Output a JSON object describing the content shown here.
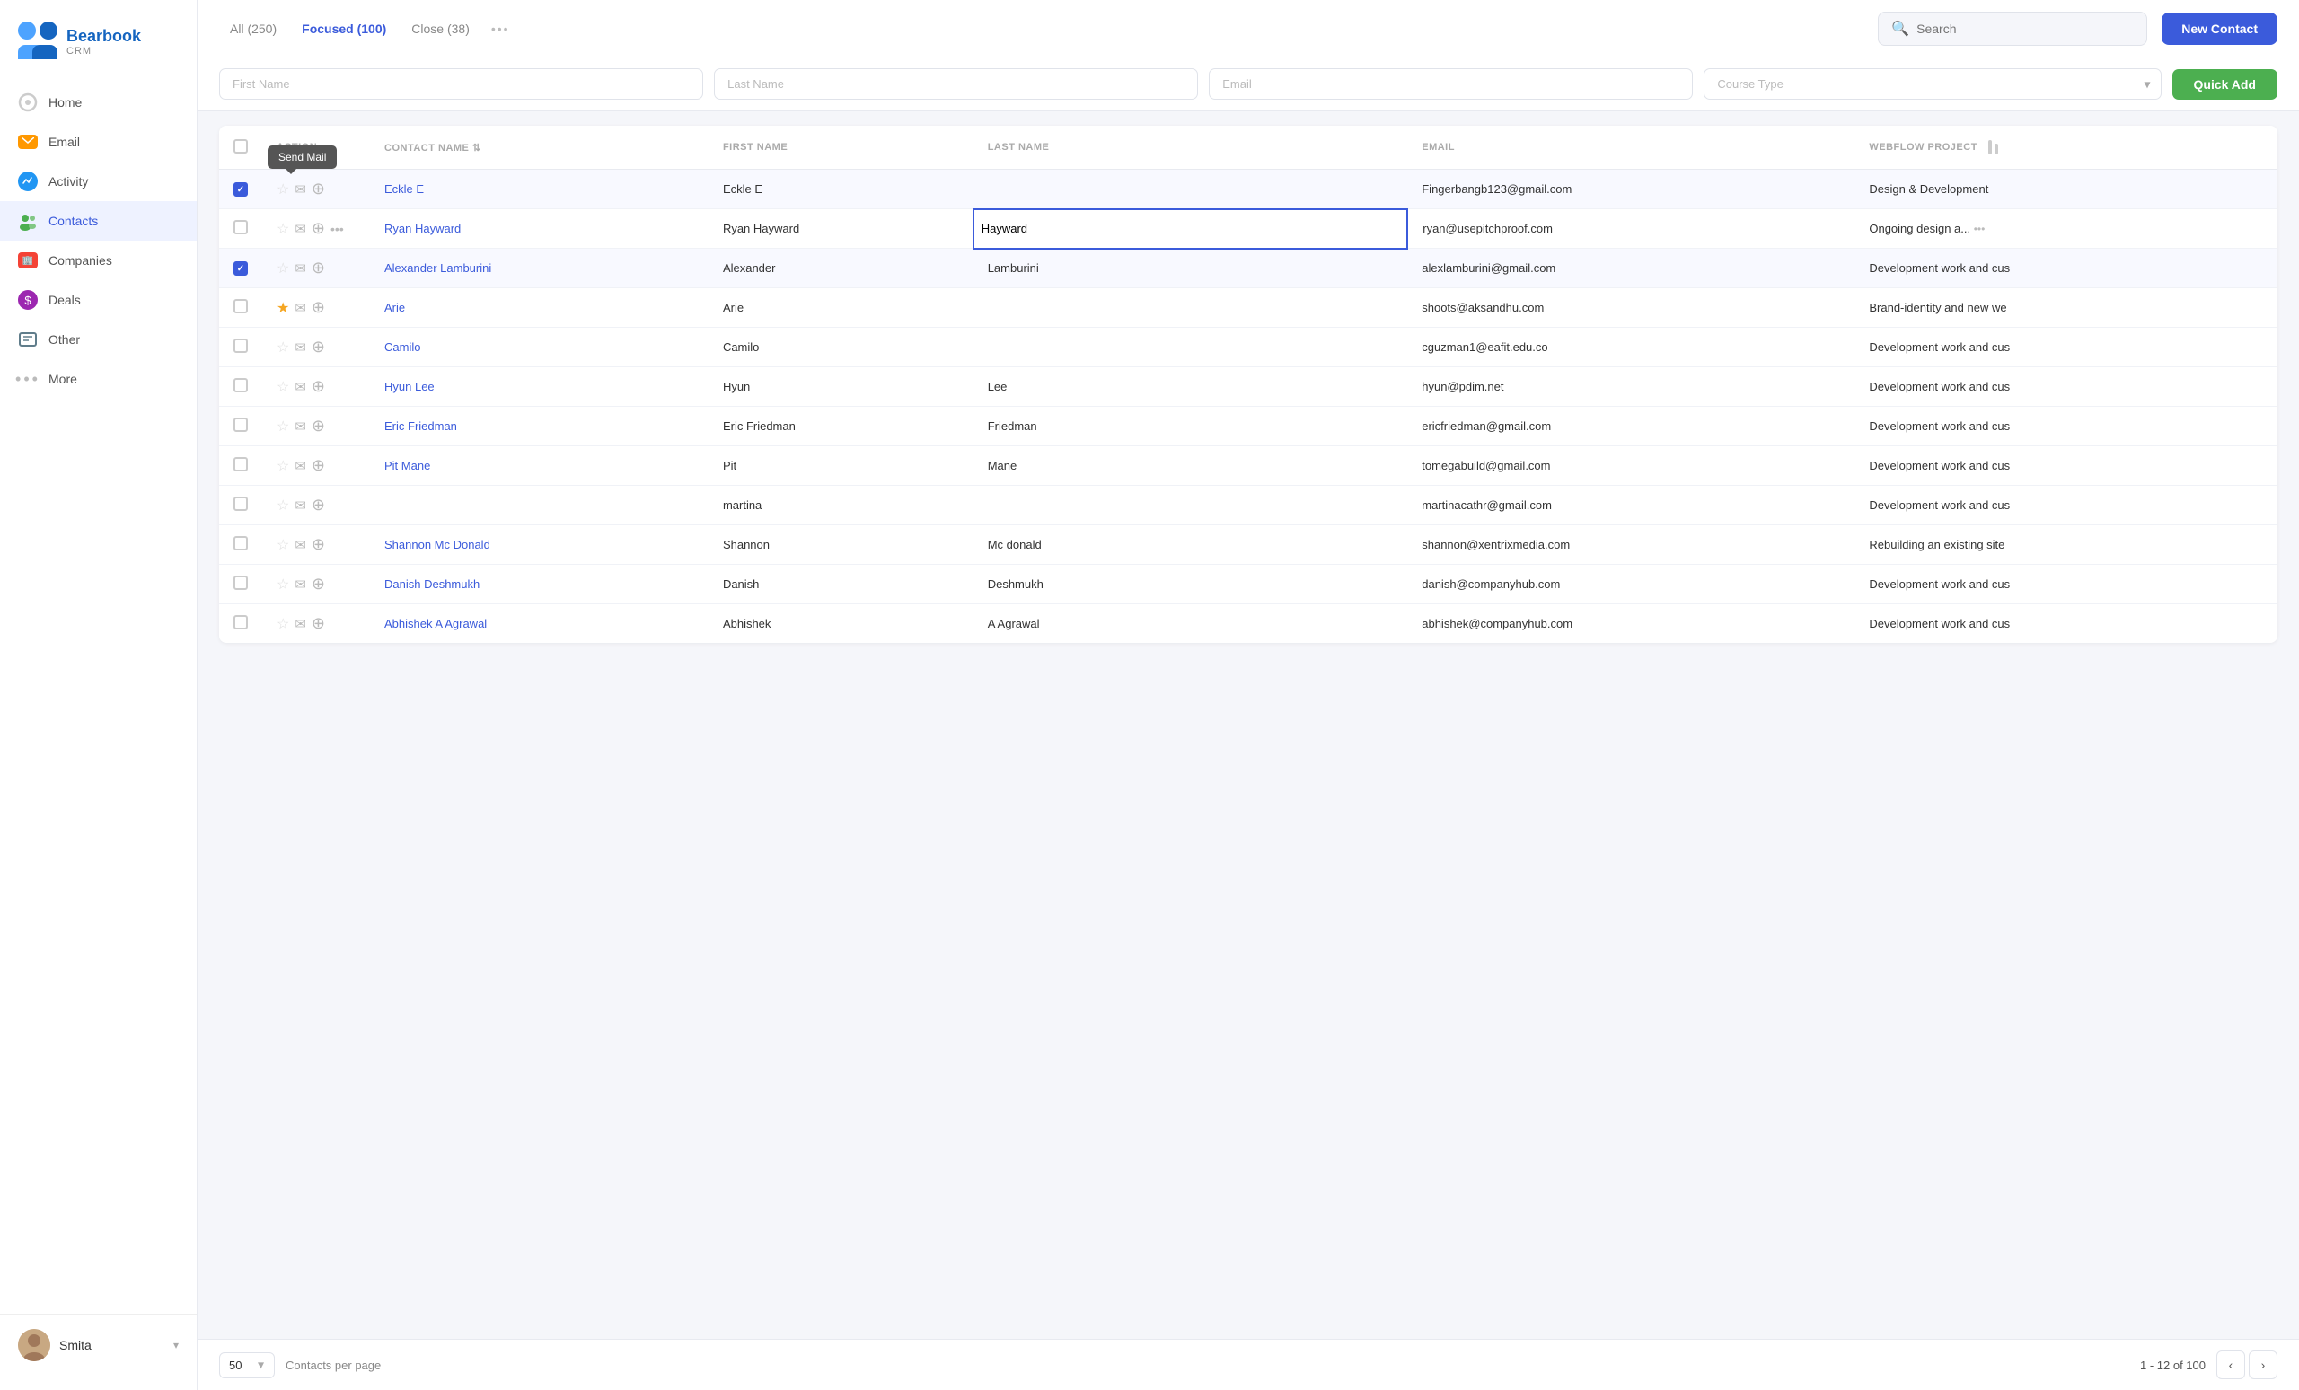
{
  "app": {
    "name": "Bearbook",
    "subtitle": "CRM"
  },
  "sidebar": {
    "nav_items": [
      {
        "id": "home",
        "label": "Home",
        "icon": "home-icon",
        "active": false
      },
      {
        "id": "email",
        "label": "Email",
        "icon": "email-icon",
        "active": false
      },
      {
        "id": "activity",
        "label": "Activity",
        "icon": "activity-icon",
        "active": false
      },
      {
        "id": "contacts",
        "label": "Contacts",
        "icon": "contacts-icon",
        "active": true
      },
      {
        "id": "companies",
        "label": "Companies",
        "icon": "companies-icon",
        "active": false
      },
      {
        "id": "deals",
        "label": "Deals",
        "icon": "deals-icon",
        "active": false
      },
      {
        "id": "other",
        "label": "Other",
        "icon": "other-icon",
        "active": false
      },
      {
        "id": "more",
        "label": "More",
        "icon": "more-icon",
        "active": false
      }
    ],
    "user": {
      "name": "Smita"
    }
  },
  "topbar": {
    "tabs": [
      {
        "label": "All (250)",
        "active": false
      },
      {
        "label": "Focused (100)",
        "active": true
      },
      {
        "label": "Close (38)",
        "active": false
      }
    ],
    "search_placeholder": "Search",
    "new_contact_label": "New Contact"
  },
  "quick_add": {
    "first_name_placeholder": "First Name",
    "last_name_placeholder": "Last Name",
    "email_placeholder": "Email",
    "course_type_label": "Course Type",
    "button_label": "Quick Add"
  },
  "table": {
    "columns": [
      "ACTION",
      "CONTACT NAME",
      "FIRST NAME",
      "LAST NAME",
      "EMAIL",
      "WEBFLOW PROJECT"
    ],
    "rows": [
      {
        "id": 1,
        "checked": true,
        "starred": false,
        "contact_name": "Eckle E",
        "first_name": "Eckle E",
        "last_name": "",
        "email": "Fingerbangb123@gmail.com",
        "webflow": "Design & Development",
        "show_tooltip": true
      },
      {
        "id": 2,
        "checked": false,
        "starred": false,
        "contact_name": "Ryan Hayward",
        "first_name": "Ryan Hayward",
        "last_name": "Hayward",
        "email": "ryan@usepitchproof.com",
        "webflow": "Ongoing design a...",
        "editing_last": true,
        "show_dots": true
      },
      {
        "id": 3,
        "checked": true,
        "starred": false,
        "contact_name": "Alexander Lamburini",
        "first_name": "Alexander",
        "last_name": "Lamburini",
        "email": "alexlamburini@gmail.com",
        "webflow": "Development work and cus"
      },
      {
        "id": 4,
        "checked": false,
        "starred": true,
        "contact_name": "Arie",
        "first_name": "Arie",
        "last_name": "",
        "email": "shoots@aksandhu.com",
        "webflow": "Brand-identity and new we"
      },
      {
        "id": 5,
        "checked": false,
        "starred": false,
        "contact_name": "Camilo",
        "first_name": "Camilo",
        "last_name": "",
        "email": "cguzman1@eafit.edu.co",
        "webflow": "Development work and cus"
      },
      {
        "id": 6,
        "checked": false,
        "starred": false,
        "contact_name": "Hyun Lee",
        "first_name": "Hyun",
        "last_name": "Lee",
        "email": "hyun@pdim.net",
        "webflow": "Development work and cus"
      },
      {
        "id": 7,
        "checked": false,
        "starred": false,
        "contact_name": "Eric Friedman",
        "first_name": "Eric Friedman",
        "last_name": "Friedman",
        "email": "ericfriedman@gmail.com",
        "webflow": "Development work and cus"
      },
      {
        "id": 8,
        "checked": false,
        "starred": false,
        "contact_name": "Pit Mane",
        "first_name": "Pit",
        "last_name": "Mane",
        "email": "tomegabuild@gmail.com",
        "webflow": "Development work and cus"
      },
      {
        "id": 9,
        "checked": false,
        "starred": false,
        "contact_name": "",
        "first_name": "martina",
        "last_name": "",
        "email": "martinacathr@gmail.com",
        "webflow": "Development work and cus"
      },
      {
        "id": 10,
        "checked": false,
        "starred": false,
        "contact_name": "Shannon Mc Donald",
        "first_name": "Shannon",
        "last_name": "Mc donald",
        "email": "shannon@xentrixmedia.com",
        "webflow": "Rebuilding an existing site"
      },
      {
        "id": 11,
        "checked": false,
        "starred": false,
        "contact_name": "Danish Deshmukh",
        "first_name": "Danish",
        "last_name": "Deshmukh",
        "email": "danish@companyhub.com",
        "webflow": "Development work and cus"
      },
      {
        "id": 12,
        "checked": false,
        "starred": false,
        "contact_name": "Abhishek A Agrawal",
        "first_name": "Abhishek",
        "last_name": "A Agrawal",
        "email": "abhishek@companyhub.com",
        "webflow": "Development work and cus"
      }
    ]
  },
  "pagination": {
    "per_page": "50",
    "per_page_label": "Contacts per page",
    "info": "1 - 12 of 100",
    "tooltip_send_mail": "Send Mail"
  }
}
